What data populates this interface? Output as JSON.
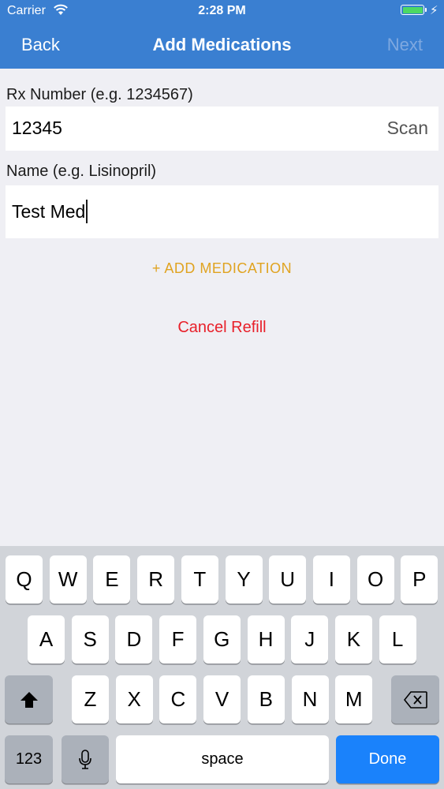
{
  "status_bar": {
    "carrier": "Carrier",
    "time": "2:28 PM"
  },
  "nav": {
    "back": "Back",
    "title": "Add Medications",
    "next": "Next"
  },
  "form": {
    "rx_label": "Rx Number (e.g. 1234567)",
    "rx_value": "12345",
    "scan": "Scan",
    "name_label": "Name (e.g. Lisinopril)",
    "name_value": "Test Med"
  },
  "actions": {
    "add_medication": "+ ADD  MEDICATION",
    "cancel_refill": "Cancel Refill"
  },
  "keyboard": {
    "row1": [
      "Q",
      "W",
      "E",
      "R",
      "T",
      "Y",
      "U",
      "I",
      "O",
      "P"
    ],
    "row2": [
      "A",
      "S",
      "D",
      "F",
      "G",
      "H",
      "J",
      "K",
      "L"
    ],
    "row3": [
      "Z",
      "X",
      "C",
      "V",
      "B",
      "N",
      "M"
    ],
    "numbers": "123",
    "space": "space",
    "done": "Done"
  },
  "colors": {
    "nav_blue": "#3a7fd1",
    "accent_gold": "#e0a320",
    "danger_red": "#e8202a",
    "done_blue": "#1a82fb"
  }
}
